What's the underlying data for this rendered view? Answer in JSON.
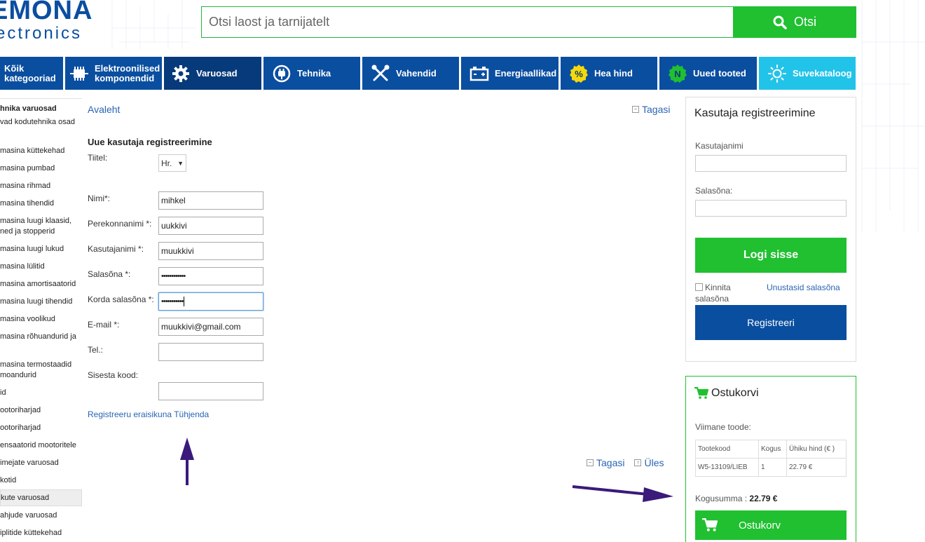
{
  "logo": {
    "line1": "EMONA",
    "line2": "ectronics"
  },
  "search": {
    "placeholder": "Otsi laost ja tarnijatelt",
    "button_label": "Otsi"
  },
  "nav": {
    "items": [
      {
        "label": "Kõik kategooriad",
        "icon": "menu-icon"
      },
      {
        "label": "Elektroonilised komponendid",
        "icon": "chip-icon"
      },
      {
        "label": "Varuosad",
        "icon": "gear-icon"
      },
      {
        "label": "Tehnika",
        "icon": "plug-icon"
      },
      {
        "label": "Vahendid",
        "icon": "tools-icon"
      },
      {
        "label": "Energiaallikad",
        "icon": "battery-icon"
      },
      {
        "label": "Hea hind",
        "icon": "percent-badge-icon"
      },
      {
        "label": "Uued tooted",
        "icon": "new-badge-icon"
      },
      {
        "label": "Suvekataloog",
        "icon": "sun-icon"
      }
    ]
  },
  "sidebar": {
    "items": [
      "hnika varuosad",
      "vad kodutehnika osad",
      "masina küttekehad",
      "masina pumbad",
      "masina rihmad",
      "masina tihendid",
      "masina luugi klaasid, ned ja stopperid",
      "masina luugi lukud",
      "masina lülitid",
      "masina amortisaatorid",
      "masina luugi tihendid",
      "masina voolikud",
      "masina rõhuandurid ja",
      "masina termostaadid moandurid",
      "id",
      "ootoriharjad",
      "ootoriharjad",
      "ensaatorid mootoritele",
      "imejate varuosad",
      "kotid",
      "kute varuosad",
      "ahjude varuosad",
      "iplitide küttekehad"
    ]
  },
  "main": {
    "breadcrumb": "Avaleht",
    "back_label": "Tagasi",
    "up_label": "Üles",
    "form_title": "Uue kasutaja registreerimine",
    "fields": {
      "title_label": "Tiitel:",
      "title_value": "Hr.",
      "first_name_label": "Nimi*:",
      "first_name_value": "mihkel",
      "last_name_label": "Perekonnanimi *:",
      "last_name_value": "uukkivi",
      "username_label": "Kasutajanimi *:",
      "username_value": "muukkivi",
      "password_label": "Salasõna *:",
      "password_value": "••••••••••••",
      "password_repeat_label": "Korda salasõna *:",
      "password_repeat_value": "•••••••••••",
      "email_label": "E-mail *:",
      "email_value": "muukkivi@gmail.com",
      "phone_label": "Tel.:",
      "phone_value": "",
      "code_label": "Sisesta kood:",
      "code_value": ""
    },
    "link_register_private": "Registreeru eraisikuna",
    "link_clear": "Tühjenda"
  },
  "login": {
    "title": "Kasutaja registreerimine",
    "username_label": "Kasutajanimi",
    "password_label": "Salasõna:",
    "login_button": "Logi sisse",
    "remember_label": "Kinnita salasõna",
    "forgot_link": "Unustasid salasõna",
    "register_button": "Registreeri"
  },
  "cart": {
    "title": "Ostukorvi",
    "last_product_label": "Viimane toode:",
    "columns": [
      "Tootekood",
      "Kogus",
      "Ühiku hind (€ )"
    ],
    "rows": [
      [
        "W5-13109/LIEB",
        "1",
        "22.79 €"
      ]
    ],
    "total_label": "Kogusumma :",
    "total_value": "22.79 €",
    "button_label": "Ostukorv"
  },
  "colors": {
    "brand_blue": "#0a4ea0",
    "accent_green": "#20c030",
    "link_blue": "#2a64b4",
    "summer_cyan": "#22c3e8",
    "annotation_purple": "#3a1a7a"
  }
}
